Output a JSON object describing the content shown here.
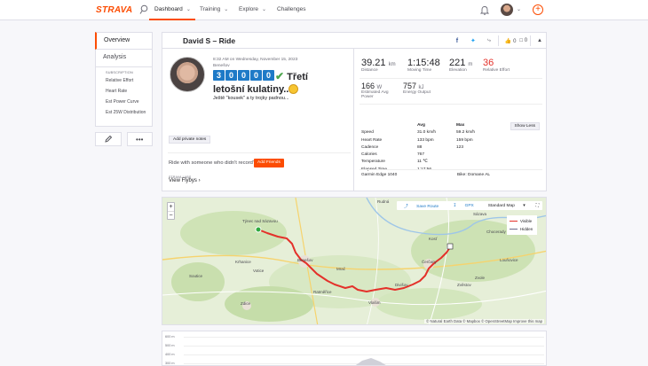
{
  "app": {
    "logo": "STRAVA"
  },
  "topnav": {
    "items": [
      {
        "label": "Dashboard",
        "active": true
      },
      {
        "label": "Training"
      },
      {
        "label": "Explore"
      },
      {
        "label": "Challenges"
      }
    ]
  },
  "sidenav": {
    "tabs": [
      "Overview",
      "Analysis"
    ],
    "subscription_header": "SUBSCRIPTION",
    "sub_items": [
      "Relative Effort",
      "Heart Rate",
      "Est Power Curve",
      "Est 25W Distribution"
    ]
  },
  "activity": {
    "header_title": "David S – Ride",
    "kudos_count": "0",
    "comments_count": "0",
    "datetime": "8:32 AM on Wednesday, November 15, 2023",
    "location": "Benešov",
    "title_digits": [
      "3",
      "0",
      "0",
      "0",
      "0"
    ],
    "title_text_a": "Třetí",
    "title_text_b": "letošní kulatiny..",
    "description": "Ještě \"kousek\" a ty trojky padnou...",
    "add_notes": "Add private notes",
    "friends_question": "Ride with someone who didn't record?",
    "add_friends": "Add Friends",
    "flyby_small": "STRAVA LABS",
    "flyby": "View Flybys"
  },
  "stats": {
    "distance": {
      "value": "39.21",
      "unit": "km",
      "label": "Distance"
    },
    "moving_time": {
      "value": "1:15:48",
      "label": "Moving Time"
    },
    "elevation": {
      "value": "221",
      "unit": "m",
      "label": "Elevation"
    },
    "relative_effort": {
      "value": "36",
      "label": "Relative Effort"
    },
    "avg_power": {
      "value": "166",
      "unit": "W",
      "label": "Estimated Avg Power"
    },
    "energy": {
      "value": "757",
      "unit": "kJ",
      "label": "Energy Output"
    },
    "show_less": "Show Less",
    "table": {
      "headers": [
        "",
        "Avg",
        "Max"
      ],
      "rows": [
        [
          "Speed",
          "31.0 km/h",
          "59.2 km/h"
        ],
        [
          "Heart Rate",
          "133 bpm",
          "159 bpm"
        ],
        [
          "Cadence",
          "88",
          "123"
        ],
        [
          "Calories",
          "767",
          ""
        ],
        [
          "Temperature",
          "11 ℃",
          ""
        ],
        [
          "Elapsed Time",
          "1:17:56",
          ""
        ]
      ]
    },
    "device": "Garmin Edge 1040",
    "bike": "Bike: Domane AL"
  },
  "map": {
    "save_route": "Save Route",
    "gpx": "GPX",
    "standard_map": "Standard Map",
    "legend_visible": "Visible",
    "legend_hidden": "Hidden",
    "attribution": "© Natural Earth Data © Mapbox © OpenStreetMap Improve this map",
    "places": [
      "Benešov",
      "Votice",
      "Krhanice",
      "Vlašim",
      "Rudná",
      "Divišov",
      "Sázava",
      "Soutice",
      "Mrač",
      "Zvole",
      "Zdice",
      "Čerčany",
      "Kosť",
      "Chocerady",
      "Zvěstov",
      "Louňovice",
      "Ratměřice",
      "Týnec nad Sázavou"
    ],
    "colors": {
      "route": "#e4312a",
      "visible": "#e4312a",
      "hidden": "#6a6a8a"
    }
  },
  "elevation_chart": {
    "y_labels": [
      "600 m",
      "500 m",
      "400 m",
      "300 m"
    ]
  }
}
